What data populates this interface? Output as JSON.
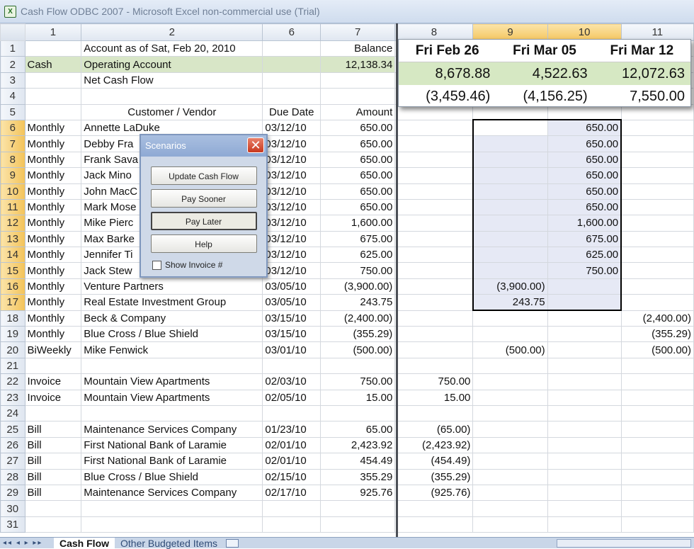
{
  "window": {
    "title": "Cash Flow ODBC 2007 - Microsoft Excel non-commercial use (Trial)",
    "icon": "X"
  },
  "columns": [
    "1",
    "2",
    "6",
    "7",
    "8",
    "9",
    "10",
    "11"
  ],
  "rows": [
    [
      "",
      "Account as of Sat, Feb 20, 2010",
      "",
      "Balance",
      "",
      "",
      "",
      ""
    ],
    [
      "Cash",
      "Operating Account",
      "",
      "12,138.34",
      "",
      "",
      "",
      ""
    ],
    [
      "",
      "Net Cash Flow",
      "",
      "",
      "",
      "",
      "",
      ""
    ],
    [
      "",
      "",
      "",
      "",
      "",
      "",
      "",
      ""
    ],
    [
      "",
      "Customer / Vendor",
      "Due Date",
      "Amount",
      "",
      "",
      "",
      ""
    ],
    [
      "Monthly",
      "Annette LaDuke",
      "03/12/10",
      "650.00",
      "",
      "",
      "650.00",
      ""
    ],
    [
      "Monthly",
      "Debby Fra",
      "03/12/10",
      "650.00",
      "",
      "",
      "650.00",
      ""
    ],
    [
      "Monthly",
      "Frank Sava",
      "03/12/10",
      "650.00",
      "",
      "",
      "650.00",
      ""
    ],
    [
      "Monthly",
      "Jack Mino",
      "03/12/10",
      "650.00",
      "",
      "",
      "650.00",
      ""
    ],
    [
      "Monthly",
      "John MacC",
      "03/12/10",
      "650.00",
      "",
      "",
      "650.00",
      ""
    ],
    [
      "Monthly",
      "Mark Mose",
      "03/12/10",
      "650.00",
      "",
      "",
      "650.00",
      ""
    ],
    [
      "Monthly",
      "Mike Pierc",
      "03/12/10",
      "1,600.00",
      "",
      "",
      "1,600.00",
      ""
    ],
    [
      "Monthly",
      "Max Barke",
      "03/12/10",
      "675.00",
      "",
      "",
      "675.00",
      ""
    ],
    [
      "Monthly",
      "Jennifer Ti",
      "03/12/10",
      "625.00",
      "",
      "",
      "625.00",
      ""
    ],
    [
      "Monthly",
      "Jack Stew",
      "03/12/10",
      "750.00",
      "",
      "",
      "750.00",
      ""
    ],
    [
      "Monthly",
      "Venture Partners",
      "03/05/10",
      "(3,900.00)",
      "",
      "(3,900.00)",
      "",
      ""
    ],
    [
      "Monthly",
      "Real Estate Investment Group",
      "03/05/10",
      "243.75",
      "",
      "243.75",
      "",
      ""
    ],
    [
      "Monthly",
      "Beck & Company",
      "03/15/10",
      "(2,400.00)",
      "",
      "",
      "",
      "(2,400.00)"
    ],
    [
      "Monthly",
      "Blue Cross / Blue Shield",
      "03/15/10",
      "(355.29)",
      "",
      "",
      "",
      "(355.29)"
    ],
    [
      "BiWeekly",
      "Mike Fenwick",
      "03/01/10",
      "(500.00)",
      "",
      "(500.00)",
      "",
      "(500.00)"
    ],
    [
      "",
      "",
      "",
      "",
      "",
      "",
      "",
      ""
    ],
    [
      "Invoice",
      "Mountain View Apartments",
      "02/03/10",
      "750.00",
      "750.00",
      "",
      "",
      ""
    ],
    [
      "Invoice",
      "Mountain View Apartments",
      "02/05/10",
      "15.00",
      "15.00",
      "",
      "",
      ""
    ],
    [
      "",
      "",
      "",
      "",
      "",
      "",
      "",
      ""
    ],
    [
      "Bill",
      "Maintenance Services Company",
      "01/23/10",
      "65.00",
      "(65.00)",
      "",
      "",
      ""
    ],
    [
      "Bill",
      "First National Bank of Laramie",
      "02/01/10",
      "2,423.92",
      "(2,423.92)",
      "",
      "",
      ""
    ],
    [
      "Bill",
      "First National Bank of Laramie",
      "02/01/10",
      "454.49",
      "(454.49)",
      "",
      "",
      ""
    ],
    [
      "Bill",
      "Blue Cross / Blue Shield",
      "02/15/10",
      "355.29",
      "(355.29)",
      "",
      "",
      ""
    ],
    [
      "Bill",
      "Maintenance Services Company",
      "02/17/10",
      "925.76",
      "(925.76)",
      "",
      "",
      ""
    ],
    [
      "",
      "",
      "",
      "",
      "",
      "",
      "",
      ""
    ],
    [
      "",
      "",
      "",
      "",
      "",
      "",
      "",
      ""
    ]
  ],
  "panel": {
    "dates": [
      "Fri Feb 26",
      "Fri Mar 05",
      "Fri Mar 12"
    ],
    "balances": [
      "8,678.88",
      "4,522.63",
      "12,072.63"
    ],
    "net": [
      "(3,459.46)",
      "(4,156.25)",
      "7,550.00"
    ]
  },
  "dialog": {
    "title": "Scenarios",
    "buttons": [
      "Update Cash Flow",
      "Pay Sooner",
      "Pay Later",
      "Help"
    ],
    "checkbox_label": "Show Invoice #"
  },
  "tabs": {
    "nav": "◂◂ ◂ ▸ ▸▸",
    "sheets": [
      "Cash Flow",
      "Other Budgeted Items"
    ]
  },
  "colors": {
    "cash_row": "#d8e6c7",
    "selection": "#e6e9f5",
    "header_selected": "#f4c55e"
  }
}
